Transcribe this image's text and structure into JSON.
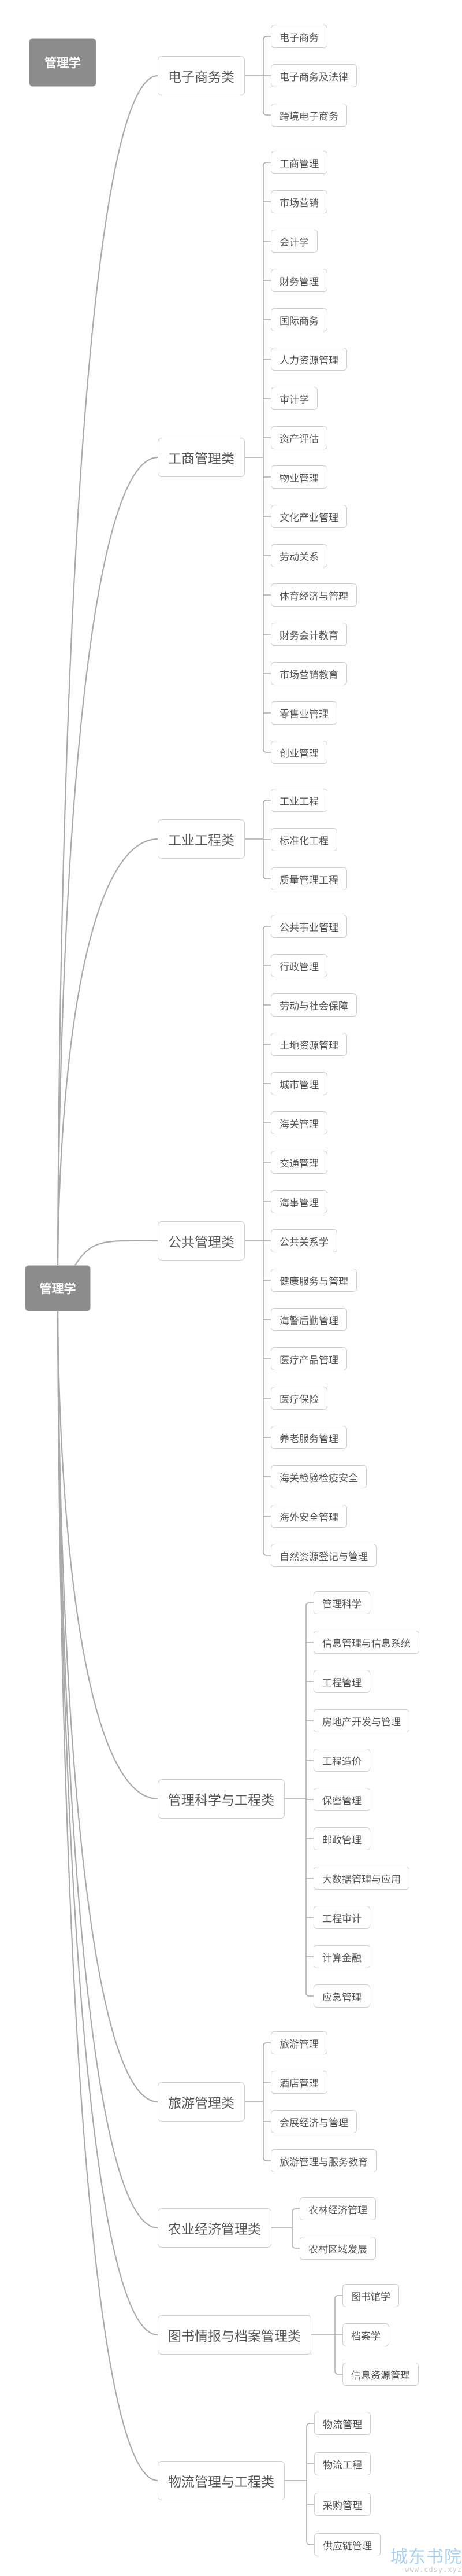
{
  "mindmap": {
    "title_node": "管理学",
    "root": "管理学",
    "categories": [
      {
        "label": "电子商务类",
        "majors": [
          "电子商务",
          "电子商务及法律",
          "跨境电子商务"
        ]
      },
      {
        "label": "工商管理类",
        "majors": [
          "工商管理",
          "市场营销",
          "会计学",
          "财务管理",
          "国际商务",
          "人力资源管理",
          "审计学",
          "资产评估",
          "物业管理",
          "文化产业管理",
          "劳动关系",
          "体育经济与管理",
          "财务会计教育",
          "市场营销教育",
          "零售业管理",
          "创业管理"
        ]
      },
      {
        "label": "工业工程类",
        "majors": [
          "工业工程",
          "标准化工程",
          "质量管理工程"
        ]
      },
      {
        "label": "公共管理类",
        "majors": [
          "公共事业管理",
          "行政管理",
          "劳动与社会保障",
          "土地资源管理",
          "城市管理",
          "海关管理",
          "交通管理",
          "海事管理",
          "公共关系学",
          "健康服务与管理",
          "海警后勤管理",
          "医疗产品管理",
          "医疗保险",
          "养老服务管理",
          "海关检验检疫安全",
          "海外安全管理",
          "自然资源登记与管理"
        ]
      },
      {
        "label": "管理科学与工程类",
        "majors": [
          "管理科学",
          "信息管理与信息系统",
          "工程管理",
          "房地产开发与管理",
          "工程造价",
          "保密管理",
          "邮政管理",
          "大数据管理与应用",
          "工程审计",
          "计算金融",
          "应急管理"
        ]
      },
      {
        "label": "旅游管理类",
        "majors": [
          "旅游管理",
          "酒店管理",
          "会展经济与管理",
          "旅游管理与服务教育"
        ]
      },
      {
        "label": "农业经济管理类",
        "majors": [
          "农林经济管理",
          "农村区域发展"
        ]
      },
      {
        "label": "图书情报与档案管理类",
        "majors": [
          "图书馆学",
          "档案学",
          "信息资源管理"
        ]
      },
      {
        "label": "物流管理与工程类",
        "majors": [
          "物流管理",
          "物流工程",
          "采购管理",
          "供应链管理"
        ]
      }
    ]
  },
  "watermark": {
    "name": "城东书院",
    "url": "www.cdsy.xyz"
  },
  "colors": {
    "root_fill": "#8c8c8c",
    "node_border": "#cfcfcf",
    "text": "#555555",
    "line": "#aaaaaa",
    "watermark": "#a9cff0"
  }
}
